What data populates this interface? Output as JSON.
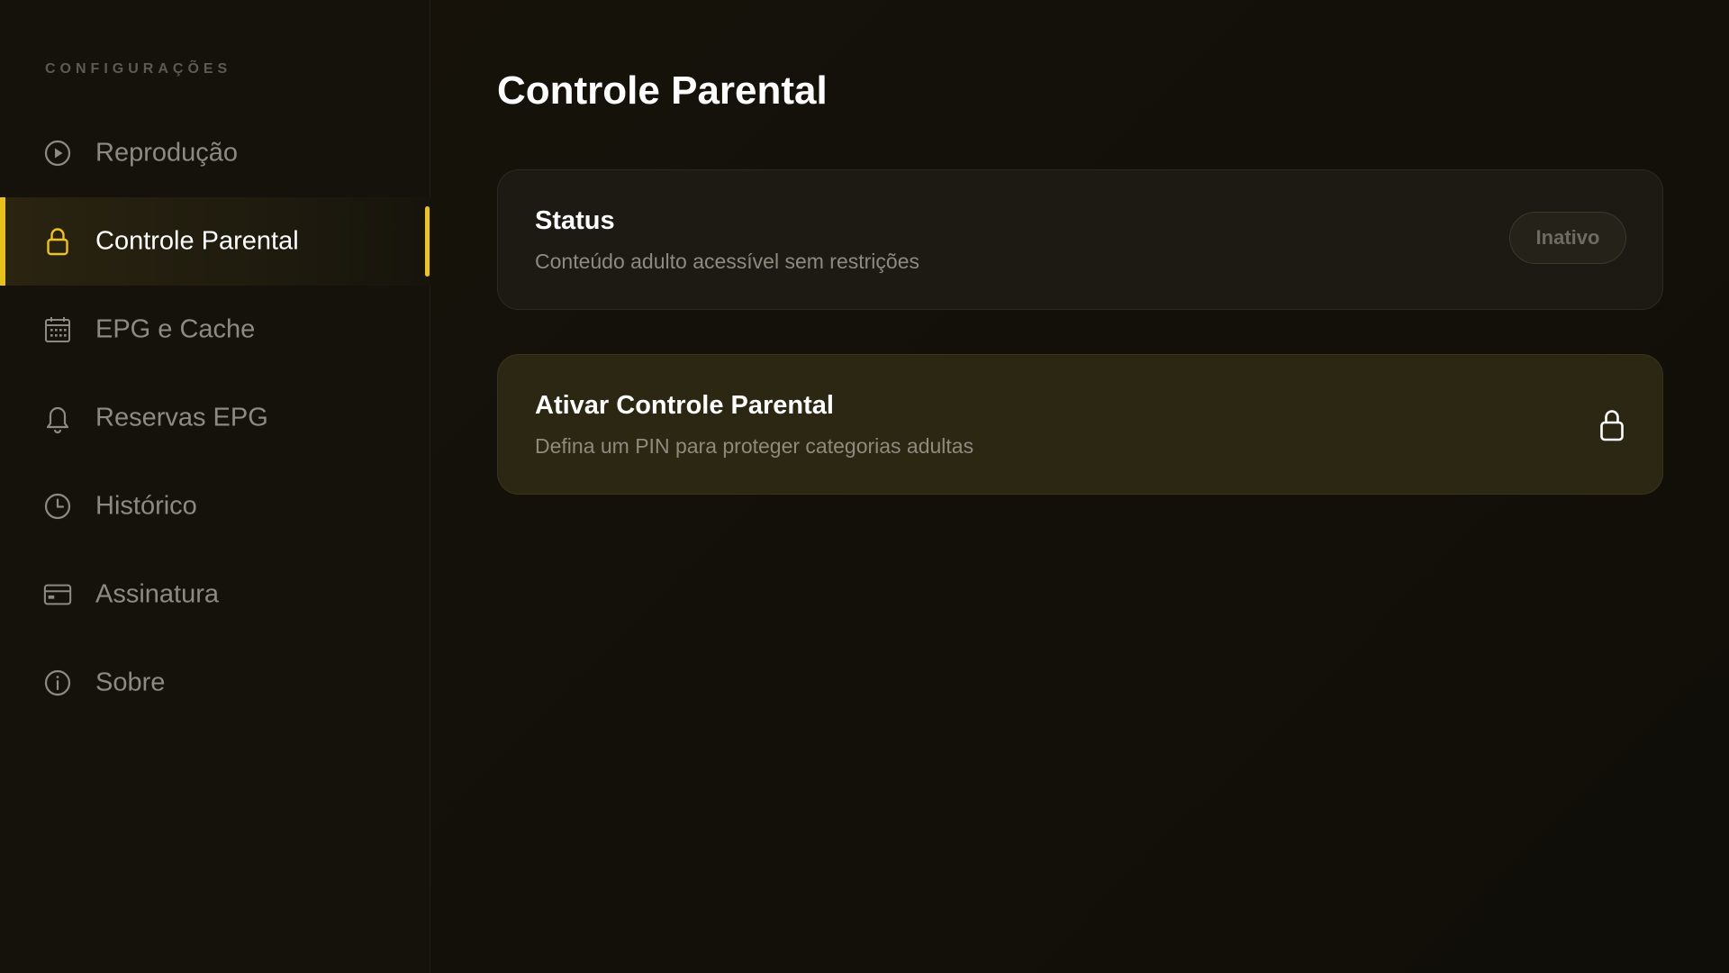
{
  "sidebar": {
    "heading": "CONFIGURAÇÕES",
    "items": [
      {
        "label": "Reprodução",
        "icon": "play-circle-icon"
      },
      {
        "label": "Controle Parental",
        "icon": "lock-icon",
        "active": true
      },
      {
        "label": "EPG e Cache",
        "icon": "calendar-icon"
      },
      {
        "label": "Reservas EPG",
        "icon": "bell-icon"
      },
      {
        "label": "Histórico",
        "icon": "clock-icon"
      },
      {
        "label": "Assinatura",
        "icon": "credit-card-icon"
      },
      {
        "label": "Sobre",
        "icon": "info-icon"
      }
    ]
  },
  "main": {
    "title": "Controle Parental",
    "status_card": {
      "title": "Status",
      "subtitle": "Conteúdo adulto acessível sem restrições",
      "badge": "Inativo"
    },
    "activate_card": {
      "title": "Ativar Controle Parental",
      "subtitle": "Defina um PIN para proteger categorias adultas",
      "icon": "lock-icon"
    }
  },
  "colors": {
    "accent": "#f0c414",
    "background": "#151109",
    "card": "#1d1a14",
    "card_highlight": "#2c2712",
    "muted_text": "#8d8a83"
  }
}
